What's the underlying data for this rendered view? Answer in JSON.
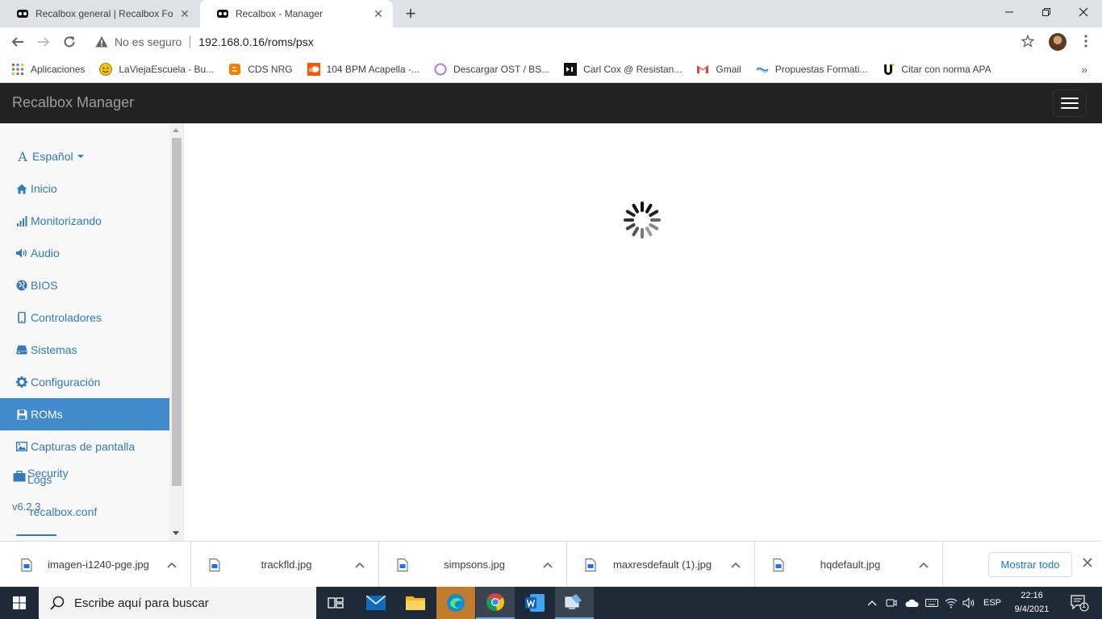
{
  "browser": {
    "tabs": [
      {
        "title": "Recalbox general | Recalbox Foru",
        "active": false,
        "favicon": "recalbox-icon"
      },
      {
        "title": "Recalbox - Manager",
        "active": true,
        "favicon": "recalbox-icon"
      }
    ],
    "omnibox": {
      "security_label": "No es seguro",
      "url": "192.168.0.16/roms/psx"
    },
    "bookmarks": [
      {
        "label": "Aplicaciones",
        "icon": "apps-grid-icon"
      },
      {
        "label": "LaViejaEscuela - Bu...",
        "icon": "smiley-icon"
      },
      {
        "label": "CDS NRG",
        "icon": "blogger-icon"
      },
      {
        "label": "104 BPM Acapella -...",
        "icon": "soundcloud-icon"
      },
      {
        "label": "Descargar OST / BS...",
        "icon": "circle-icon"
      },
      {
        "label": "Carl Cox @ Resistan...",
        "icon": "mixcloud-icon"
      },
      {
        "label": "Gmail",
        "icon": "gmail-icon"
      },
      {
        "label": "Propuestas Formati...",
        "icon": "site-icon"
      },
      {
        "label": "Citar con norma APA",
        "icon": "u-icon"
      }
    ]
  },
  "app": {
    "brand": "Recalbox Manager",
    "sidebar": {
      "language": "Español",
      "items": [
        {
          "label": "Inicio",
          "icon": "home-icon",
          "active": false
        },
        {
          "label": "Monitorizando",
          "icon": "signal-icon",
          "active": false
        },
        {
          "label": "Audio",
          "icon": "volume-icon",
          "active": false
        },
        {
          "label": "BIOS",
          "icon": "globe-icon",
          "active": false
        },
        {
          "label": "Controladores",
          "icon": "phone-icon",
          "active": false
        },
        {
          "label": "Sistemas",
          "icon": "hdd-icon",
          "active": false
        },
        {
          "label": "Configuración",
          "icon": "cog-icon",
          "active": false
        },
        {
          "label": "ROMs",
          "icon": "floppy-icon",
          "active": true
        },
        {
          "label": "Capturas de pantalla",
          "icon": "picture-icon",
          "active": false
        }
      ],
      "overlap_items": {
        "security": "Security",
        "logs": "Logs",
        "version": "v6.2.3",
        "recalbox_conf": "recalbox.conf"
      }
    }
  },
  "downloads": {
    "items": [
      {
        "name": "imagen-i1240-pge.jpg"
      },
      {
        "name": "trackfld.jpg"
      },
      {
        "name": "simpsons.jpg"
      },
      {
        "name": "maxresdefault (1).jpg"
      },
      {
        "name": "hqdefault.jpg"
      }
    ],
    "show_all": "Mostrar todo"
  },
  "taskbar": {
    "search_placeholder": "Escribe aquí para buscar",
    "language": "ESP",
    "time": "22:16",
    "date": "9/4/2021",
    "notifications": "1"
  }
}
